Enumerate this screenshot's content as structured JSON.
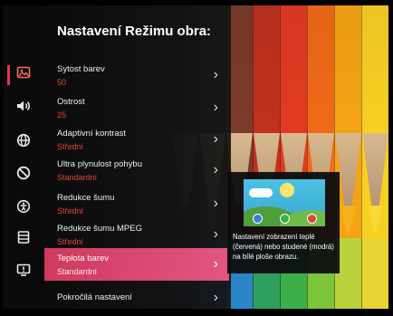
{
  "panel": {
    "title": "Nastavení Režimu obra:",
    "items": [
      {
        "label": "Sytost barev",
        "value": "50"
      },
      {
        "label": "Ostrost",
        "value": "25"
      },
      {
        "label": "Adaptivní kontrast",
        "value": "Střední"
      },
      {
        "label": "Ultra plynulost pohybu",
        "value": "Standardní"
      },
      {
        "label": "Redukce šumu",
        "value": "Střední"
      },
      {
        "label": "Redukce šumu MPEG",
        "value": "Střední"
      },
      {
        "label": "Teplota barev",
        "value": "Standardní"
      },
      {
        "label": "Pokročilá nastavení"
      }
    ],
    "selected_index": 6
  },
  "sidebar": {
    "items": [
      {
        "icon": "picture-icon",
        "active": true
      },
      {
        "icon": "sound-icon"
      },
      {
        "icon": "network-globe-icon"
      },
      {
        "icon": "no-disturb-icon"
      },
      {
        "icon": "accessibility-icon"
      },
      {
        "icon": "list-icon"
      },
      {
        "icon": "support-icon"
      }
    ]
  },
  "info_card": {
    "text": "Nastavení zobrazení teplé (červená) nebo studené (modrá) na bílé ploše obrazu."
  },
  "colors": {
    "accent": "#e3364f",
    "selected_row": "#d8466f",
    "value_text": "#e0463a"
  }
}
